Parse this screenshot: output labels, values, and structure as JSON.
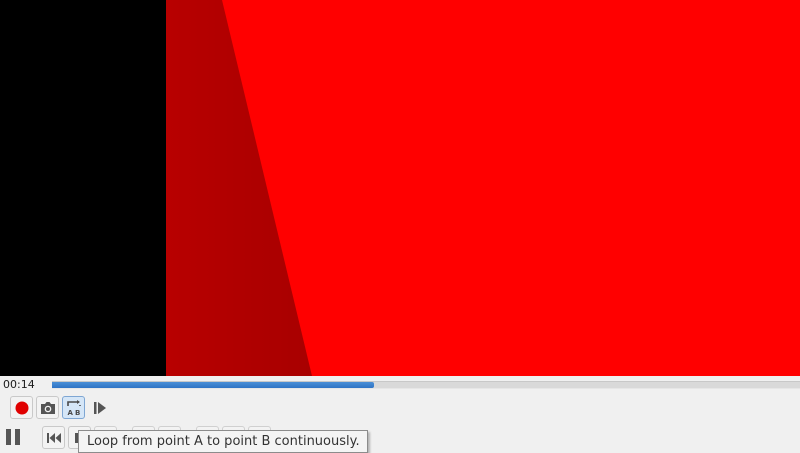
{
  "video": {
    "colors": {
      "red": "#ff0000",
      "dark_red": "#b00000",
      "black": "#000000"
    }
  },
  "seekbar": {
    "time_elapsed": "00:14",
    "progress_fraction": 0.43,
    "fill_color": "#2f74c4"
  },
  "toolbar": {
    "advanced": [
      {
        "name": "record",
        "icon": "record-dot-icon",
        "color": "#e00000"
      },
      {
        "name": "snapshot",
        "icon": "camera-icon"
      },
      {
        "name": "loop-ab",
        "icon": "loop-ab-icon",
        "state": "hovered"
      },
      {
        "name": "frame-by-frame",
        "icon": "frame-step-icon"
      }
    ],
    "main": [
      {
        "name": "play-pause",
        "icon": "pause-icon"
      },
      {
        "name": "previous",
        "icon": "skip-previous-icon"
      },
      {
        "name": "stop",
        "icon": "stop-icon"
      }
    ]
  },
  "tooltip": {
    "text": "Loop from point A to point B continuously."
  }
}
